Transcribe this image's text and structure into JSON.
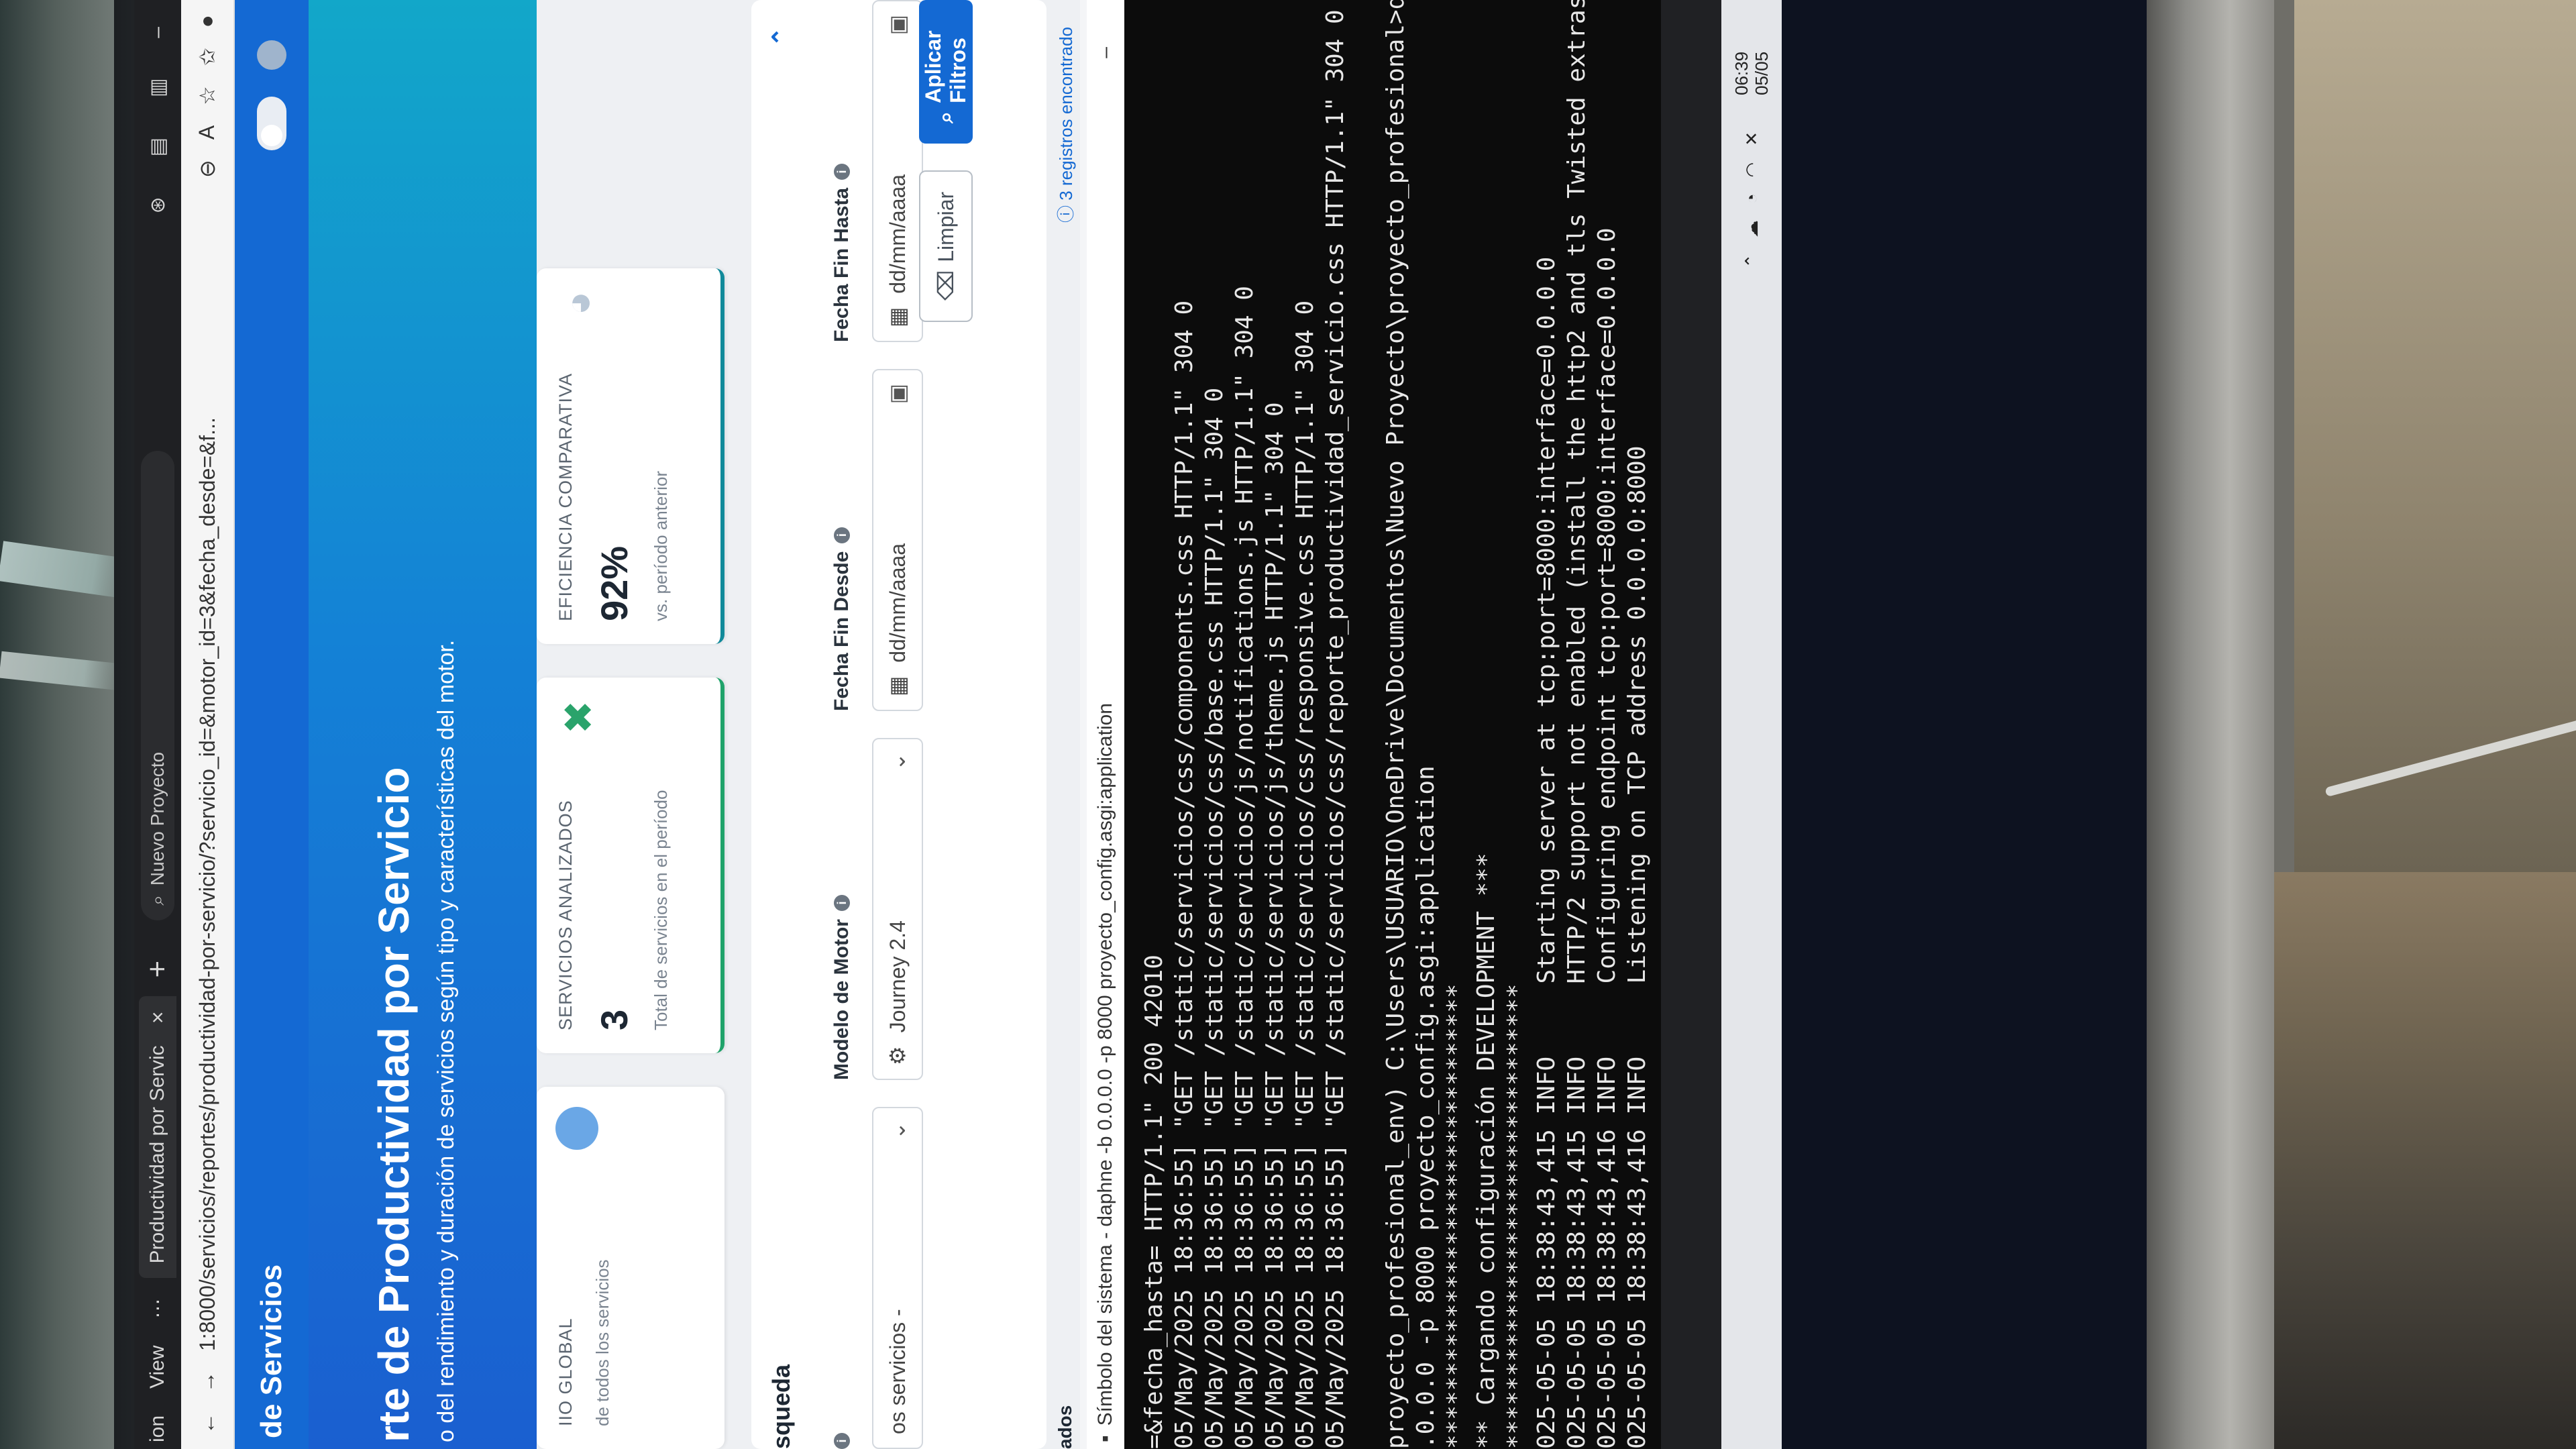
{
  "browser": {
    "menu_label": "ion",
    "view_label": "View",
    "tab_title": "Productividad por Servic",
    "tab_close": "×",
    "new_tab": "+",
    "search_placeholder": "Nuevo Proyecto",
    "url": "1:8000/servicios/reportes/productividad-por-servicio/?servicio_id=&motor_id=3&fecha_desde=&f..."
  },
  "navbar": {
    "brand": "de Servicios"
  },
  "hero": {
    "title": "rte de Productividad por Servicio",
    "subtitle": "o del rendimiento y duración de servicios según tipo y características del motor."
  },
  "cards": [
    {
      "label": "IIO GLOBAL",
      "value": "",
      "sub": "de todos los servicios"
    },
    {
      "label": "SERVICIOS ANALIZADOS",
      "value": "3",
      "sub": "Total de servicios en el período"
    },
    {
      "label": "EFICIENCIA COMPARATIVA",
      "value": "92%",
      "sub": "vs. período anterior"
    }
  ],
  "filters": {
    "title": "squeda",
    "groups": [
      {
        "label": "",
        "value": "os servicios -"
      },
      {
        "label": "Modelo de Motor",
        "value": "Journey 2.4"
      },
      {
        "label": "Fecha Fin Desde",
        "value": "dd/mm/aaaa"
      },
      {
        "label": "Fecha Fin Hasta",
        "value": "dd/mm/aaaa"
      }
    ],
    "clear_label": "Limpiar",
    "apply_label": "Aplicar Filtros"
  },
  "results": {
    "title": "ados",
    "count": "3 registros encontrado"
  },
  "terminal": {
    "title": "Símbolo del sistema - daphne  -b 0.0.0.0 -p 8000 proyecto_config.asgi:application",
    "lines": [
      "=&fecha_hasta= HTTP/1.1\" 200 42010",
      "05/May/2025 18:36:55] \"GET /static/servicios/css/components.css HTTP/1.1\" 304 0",
      "05/May/2025 18:36:55] \"GET /static/servicios/css/base.css HTTP/1.1\" 304 0",
      "05/May/2025 18:36:55] \"GET /static/servicios/js/notifications.js HTTP/1.1\" 304 0",
      "05/May/2025 18:36:55] \"GET /static/servicios/js/theme.js HTTP/1.1\" 304 0",
      "05/May/2025 18:36:55] \"GET /static/servicios/css/responsive.css HTTP/1.1\" 304 0",
      "05/May/2025 18:36:55] \"GET /static/servicios/css/reporte_productividad_servicio.css HTTP/1.1\" 304 0",
      "",
      "proyecto_profesional_env) C:\\Users\\USUARIO\\OneDrive\\Documentos\\Nuevo Proyecto\\proyecto_profesional>da",
      ".0.0.0 -p 8000 proyecto_config.asgi:application",
      "********************************",
      "** Cargando configuración DEVELOPMENT ***",
      "********************************",
      "025-05-05 18:38:43,415 INFO     Starting server at tcp:port=8000:interface=0.0.0.0",
      "025-05-05 18:38:43,415 INFO     HTTP/2 support not enabled (install the http2 and tls Twisted extras",
      "025-05-05 18:38:43,416 INFO     Configuring endpoint tcp:port=8000:interface=0.0.0.0",
      "025-05-05 18:38:43,416 INFO     Listening on TCP address 0.0.0.0:8000"
    ]
  },
  "tray": {
    "time": "06:39",
    "date": "05/05"
  }
}
